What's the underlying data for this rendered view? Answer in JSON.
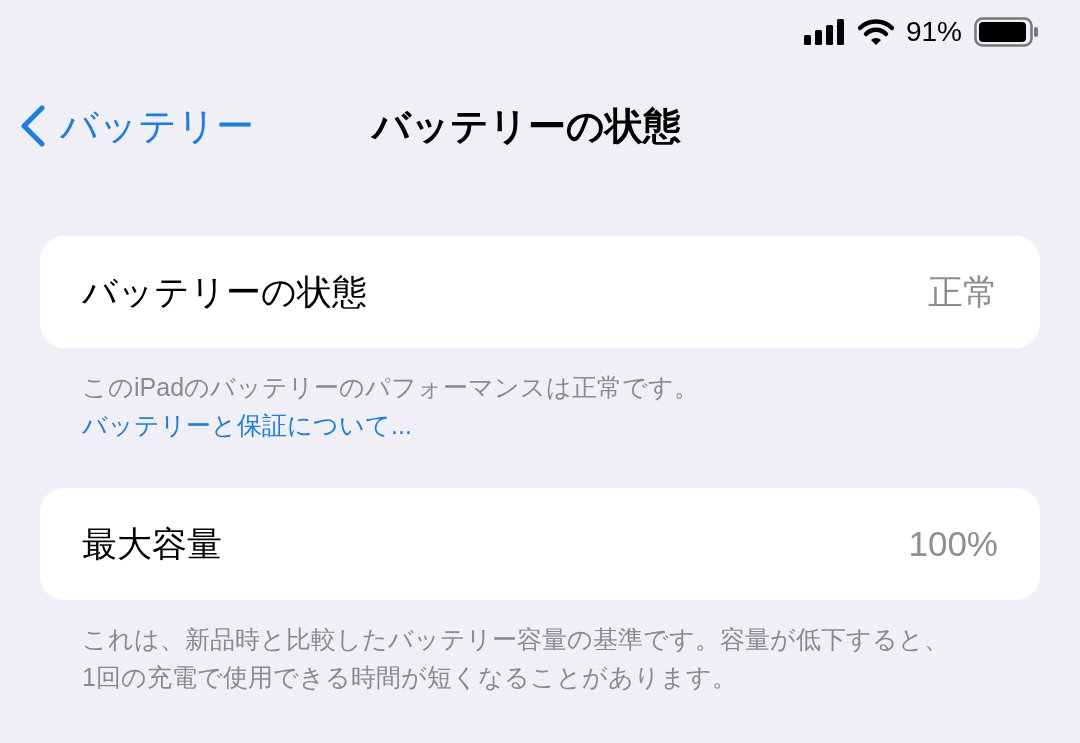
{
  "status_bar": {
    "battery": "91%"
  },
  "nav": {
    "back": "バッテリー",
    "title": "バッテリーの状態"
  },
  "sections": [
    {
      "label": "バッテリーの状態",
      "value": "正常",
      "footer": {
        "text": "このiPadのバッテリーのパフォーマンスは正常です。",
        "link": "バッテリーと保証について..."
      }
    },
    {
      "label": "最大容量",
      "value": "100%",
      "footer": {
        "text": "これは、新品時と比較したバッテリー容量の基準です。容量が低下すると、1回の充電で使用できる時間が短くなることがあります。"
      }
    }
  ]
}
